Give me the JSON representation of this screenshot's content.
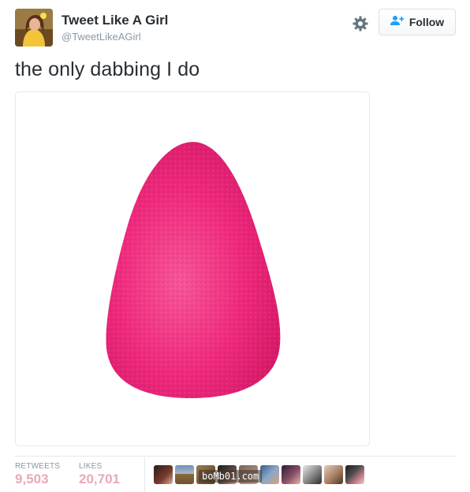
{
  "user": {
    "name": "Tweet Like A Girl",
    "handle": "@TweetLikeAGirl"
  },
  "actions": {
    "follow_label": "Follow"
  },
  "tweet": {
    "text": "the only dabbing I do"
  },
  "stats": {
    "retweets_label": "RETWEETS",
    "retweets_value": "9,503",
    "likes_label": "LIKES",
    "likes_value": "20,701"
  },
  "watermark": "boMb01.com",
  "colors": {
    "accent_blue": "#1da1f2",
    "stat_value": "#e8a9b8",
    "sponge_pink": "#f0287e"
  },
  "icons": {
    "settings": "gear-icon",
    "follow": "add-user-icon"
  }
}
